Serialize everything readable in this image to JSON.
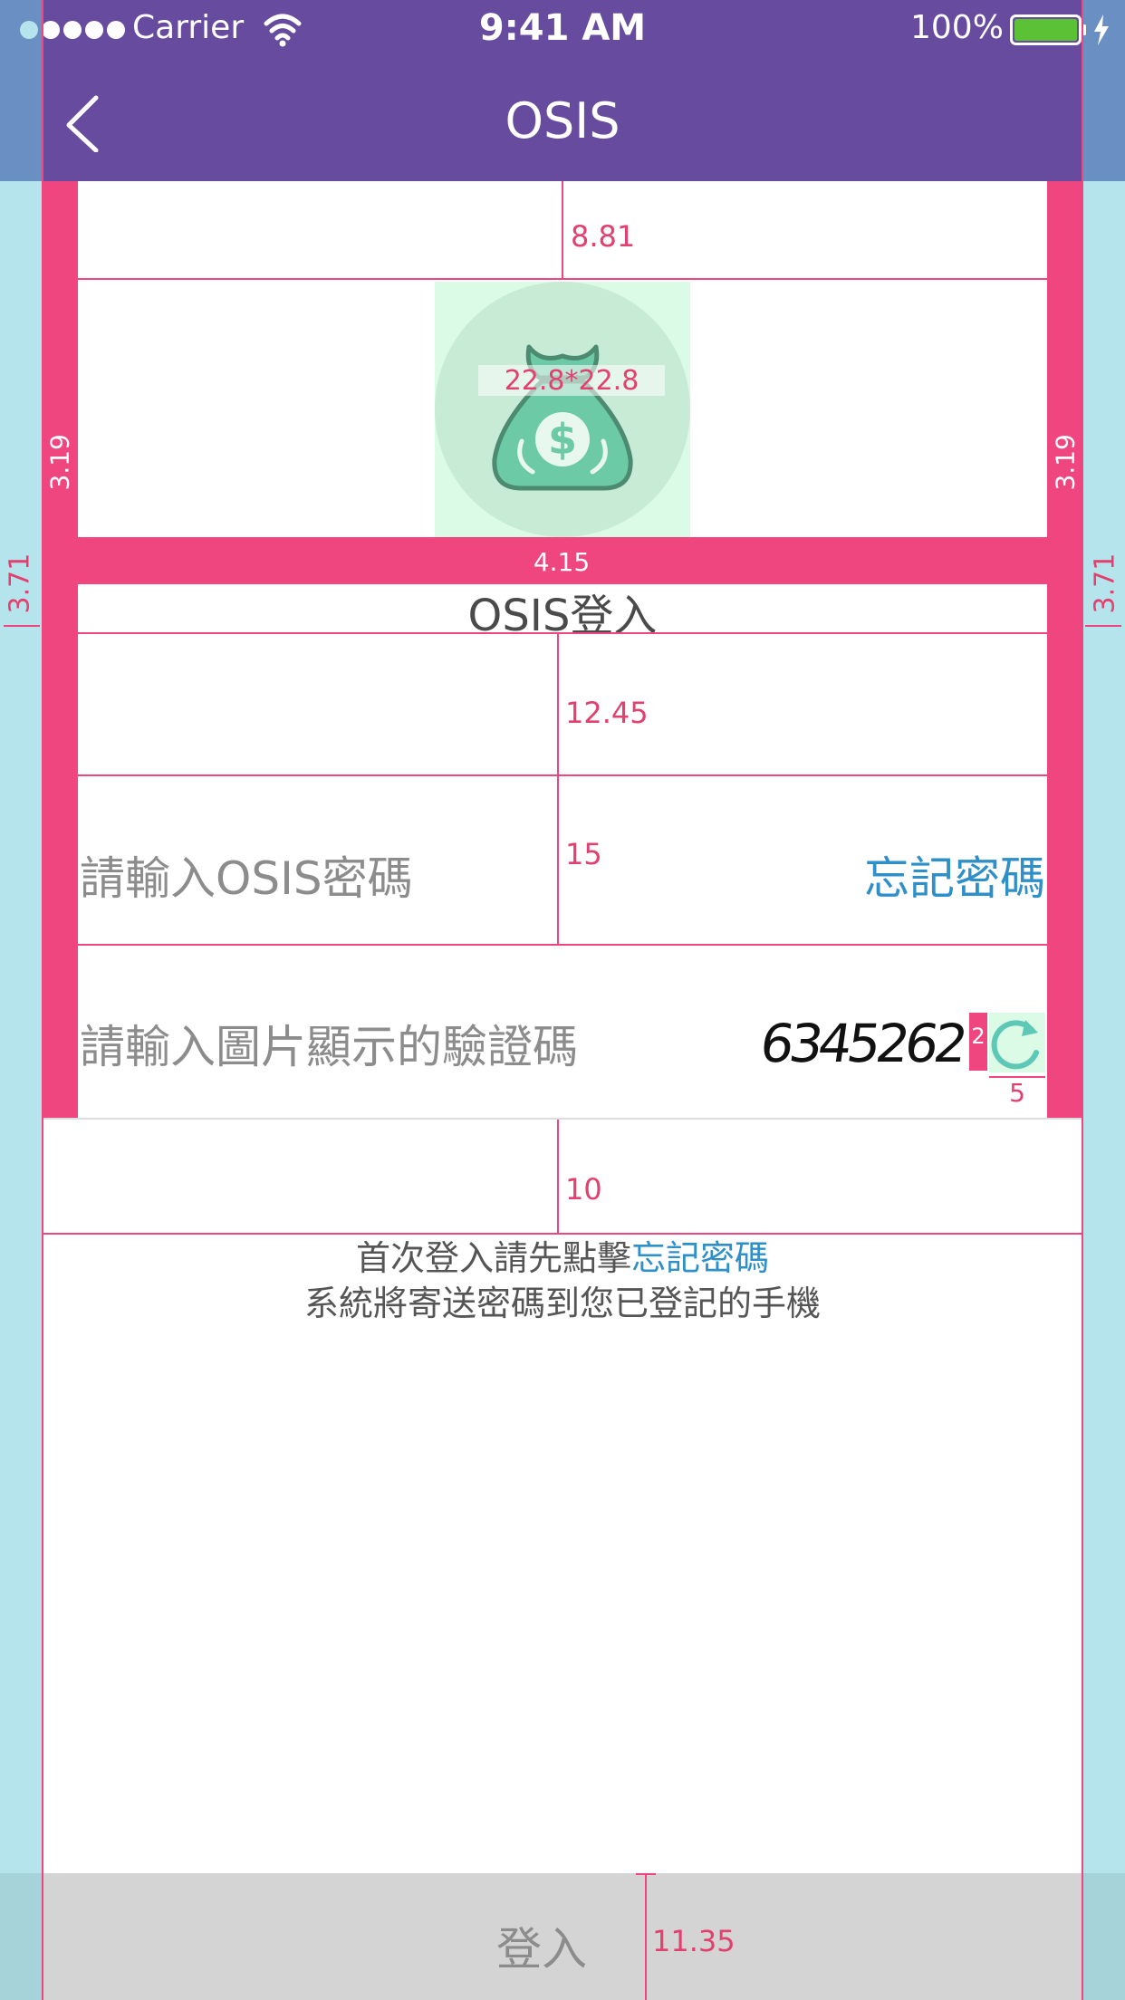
{
  "status_bar": {
    "carrier": "Carrier",
    "time": "9:41 AM",
    "battery_percent": "100%",
    "battery_level": 1.0
  },
  "nav": {
    "title": "OSIS",
    "back_icon": "chevron-left-icon"
  },
  "logo": {
    "icon": "money-bag-icon",
    "size_label": "22.8*22.8"
  },
  "login": {
    "heading": "OSIS登入",
    "password_placeholder": "請輸入OSIS密碼",
    "forgot_password": "忘記密碼",
    "captcha_placeholder": "請輸入圖片顯示的驗證碼",
    "captcha_text": "6345262",
    "refresh_icon": "refresh-icon",
    "notice_line1_prefix": "首次登入請先點擊",
    "notice_line1_link": "忘記密碼",
    "notice_line2": "系統將寄送密碼到您已登記的手機",
    "submit_label": "登入"
  },
  "measurements": {
    "top_gap": "8.81",
    "side_left": "3.19",
    "side_right": "3.19",
    "outer_left": "3.71",
    "outer_right": "3.71",
    "band_gap": "4.15",
    "row1_height": "12.45",
    "row2_height": "15",
    "captcha_gap": "2",
    "refresh_width": "5",
    "bottom_gap": "10",
    "button_height": "11.35"
  },
  "colors": {
    "nav_bg": "#674b9f",
    "accent_pink": "#ef4680",
    "link_blue": "#2f8fc9",
    "side_cyan": "#b6e4ec",
    "button_bg": "#d4d4d4",
    "icon_green": "#6ccaa6"
  }
}
